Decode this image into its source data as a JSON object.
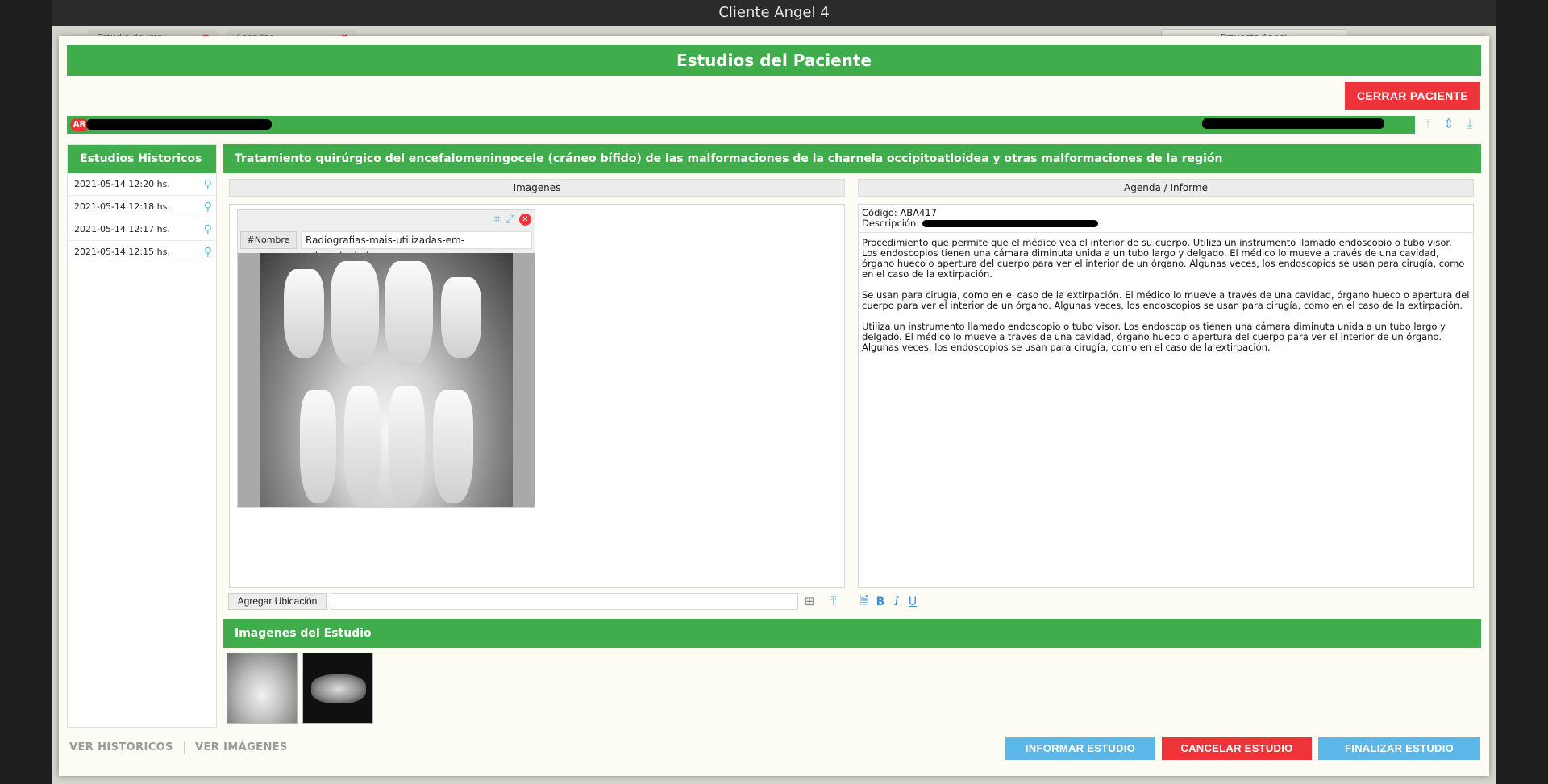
{
  "window": {
    "title": "Cliente Angel 4"
  },
  "app_background": {
    "tabs": [
      {
        "label": "Estudio de Ima"
      },
      {
        "label": "Agendas"
      }
    ],
    "project_label": "Proyecto Angel"
  },
  "modal": {
    "title": "Estudios del Paciente",
    "close_patient_label": "CERRAR PACIENTE",
    "patient_bar": {
      "country_badge": "AR"
    },
    "history": {
      "title": "Estudios Historicos",
      "items": [
        {
          "label": "2021-05-14 12:20 hs."
        },
        {
          "label": "2021-05-14 12:18 hs."
        },
        {
          "label": "2021-05-14 12:17 hs."
        },
        {
          "label": "2021-05-14 12:15 hs."
        }
      ]
    },
    "treatment_title": "Tratamiento quirúrgico del encefalomeningocele (cráneo bífido) de las malformaciones de la charnela occipitoatloidea y otras malformaciones de la región",
    "images_panel": {
      "header": "Imagenes",
      "card": {
        "name_tag": "#Nombre",
        "file_name": "Radiografias-mais-utilizadas-em-odontologia.jpg"
      },
      "add_location_label": "Agregar Ubicación"
    },
    "report_panel": {
      "header": "Agenda / Informe",
      "code_line": "Código: ABA417",
      "description_label": "Descripción:",
      "paragraphs": [
        "Procedimiento que permite que el médico vea el interior de su cuerpo. Utiliza un instrumento llamado endoscopio o tubo visor. Los endoscopios tienen una cámara diminuta unida a un tubo largo y delgado. El médico lo mueve a través de una cavidad, órgano hueco o apertura del cuerpo para ver el interior de un órgano. Algunas veces, los endoscopios se usan para cirugía, como en el caso de la extirpación.",
        "Se usan para cirugía, como en el caso de la extirpación. El médico lo mueve a través de una cavidad, órgano hueco o apertura del cuerpo para ver el interior de un órgano. Algunas veces, los endoscopios se usan para cirugía, como en el caso de la extirpación.",
        "Utiliza un instrumento llamado endoscopio o tubo visor. Los endoscopios tienen una cámara diminuta unida a un tubo largo y delgado. El médico lo mueve a través de una cavidad, órgano hueco o apertura del cuerpo para ver el interior de un órgano. Algunas veces, los endoscopios se usan para cirugía, como en el caso de la extirpación."
      ]
    },
    "study_images": {
      "title": "Imagenes del Estudio"
    },
    "footer": {
      "ver_historicos": "VER HISTORICOS",
      "ver_imagenes": "VER IMÁGENES",
      "informar": "INFORMAR ESTUDIO",
      "cancelar": "CANCELAR ESTUDIO",
      "finalizar": "FINALIZAR ESTUDIO"
    }
  },
  "colors": {
    "green": "#3fad4b",
    "red": "#ee3439",
    "blue": "#5db8ea"
  }
}
